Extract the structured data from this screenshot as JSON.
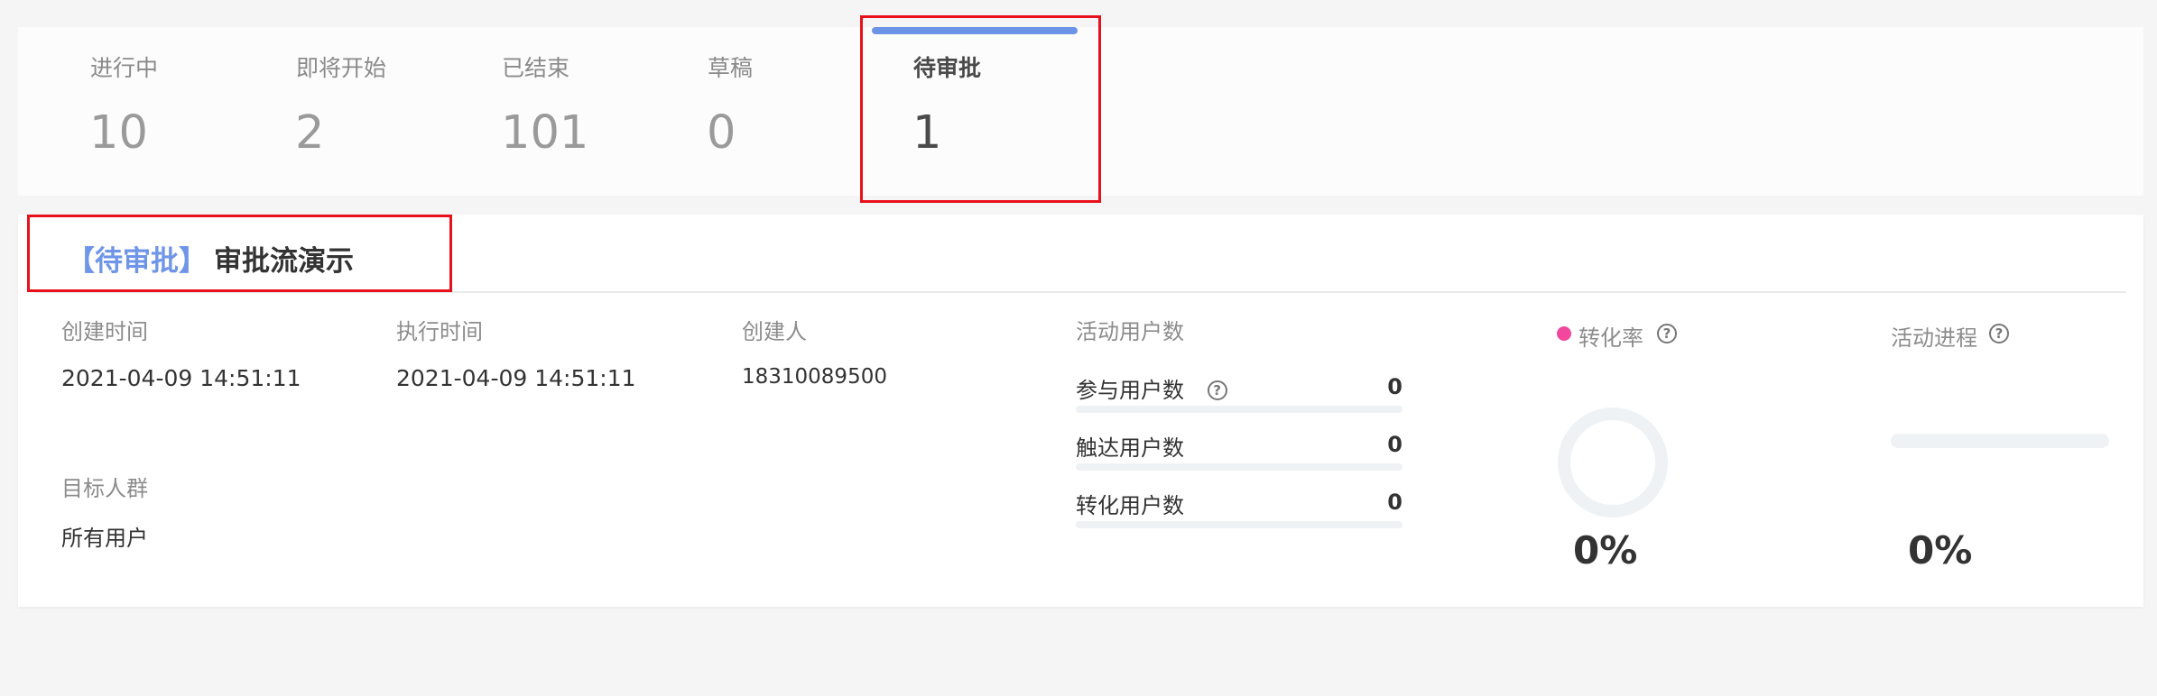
{
  "status_tabs": [
    {
      "label": "进行中",
      "count": "10"
    },
    {
      "label": "即将开始",
      "count": "2"
    },
    {
      "label": "已结束",
      "count": "101"
    },
    {
      "label": "草稿",
      "count": "0"
    },
    {
      "label": "待审批",
      "count": "1",
      "active": true
    }
  ],
  "activity": {
    "status_tag": "【待审批】",
    "name": "审批流演示",
    "created_time_label": "创建时间",
    "created_time": "2021-04-09 14:51:11",
    "exec_time_label": "执行时间",
    "exec_time": "2021-04-09 14:51:11",
    "creator_label": "创建人",
    "creator": "18310089500",
    "audience_label": "目标人群",
    "audience": "所有用户",
    "users": {
      "title": "活动用户数",
      "rows": [
        {
          "label": "参与用户数",
          "value": "0",
          "fill": 0
        },
        {
          "label": "触达用户数",
          "value": "0",
          "fill": 0
        },
        {
          "label": "转化用户数",
          "value": "0",
          "fill": 0
        }
      ],
      "help_icon": "?"
    },
    "conversion": {
      "label": "转化率",
      "value": "0%",
      "dot_color": "#f1489e",
      "help_icon": "?"
    },
    "progress": {
      "label": "活动进程",
      "value": "0%",
      "fill": 0,
      "help_icon": "?"
    }
  }
}
